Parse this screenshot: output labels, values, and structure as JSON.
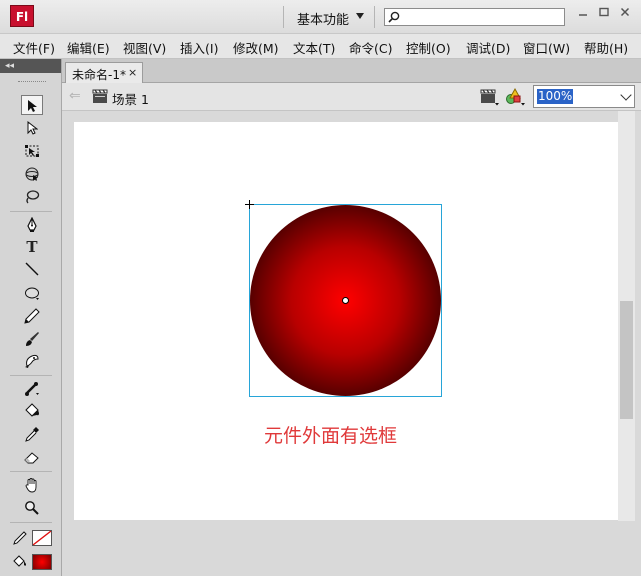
{
  "app": {
    "logo_text": "Fl",
    "workspace_label": "基本功能",
    "search_placeholder": ""
  },
  "menu": [
    "文件(F)",
    "编辑(E)",
    "视图(V)",
    "插入(I)",
    "修改(M)",
    "文本(T)",
    "命令(C)",
    "控制(O)",
    "调试(D)",
    "窗口(W)",
    "帮助(H)"
  ],
  "document": {
    "tab_label": "未命名-1*",
    "tab_close": "×",
    "scene_label": "场景 1",
    "zoom": "100%"
  },
  "stage": {
    "shape": "radial-gradient-circle",
    "fill_colors": [
      "#ff0000",
      "#000000"
    ],
    "selection_color": "#27a5d8",
    "caption": "元件外面有选框",
    "caption_color": "#e0393a"
  },
  "tools": {
    "icons": [
      "selection-icon",
      "subselection-icon",
      "free-transform-icon",
      "3d-rotation-icon",
      "lasso-icon",
      "pen-icon",
      "text-icon",
      "line-icon",
      "oval-icon",
      "pencil-icon",
      "brush-icon",
      "deco-icon",
      "bone-icon",
      "paint-bucket-icon",
      "eyedropper-icon",
      "eraser-icon",
      "hand-icon",
      "zoom-icon"
    ],
    "text_tool_label": "T",
    "stroke_color": "none",
    "fill_color": "#cc0000"
  }
}
